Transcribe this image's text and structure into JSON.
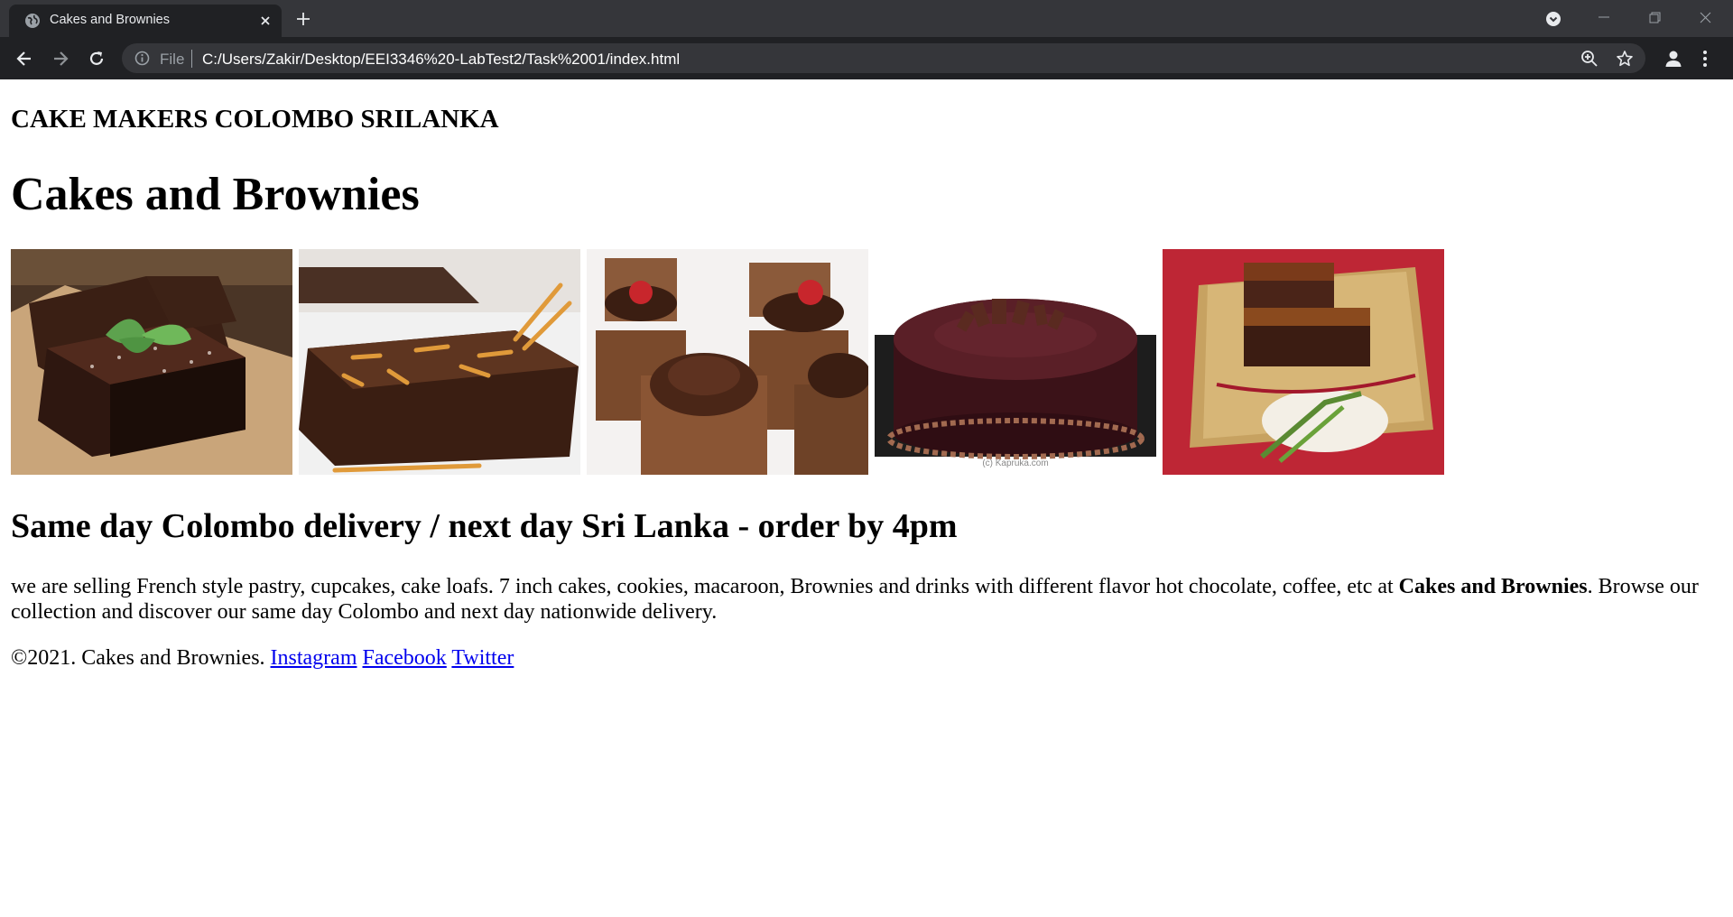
{
  "browser": {
    "tab_title": "Cakes and Brownies",
    "url_scheme": "File",
    "url": "C:/Users/Zakir/Desktop/EEI3346%20-LabTest2/Task%2001/index.html"
  },
  "page": {
    "brand_heading": "CAKE MAKERS COLOMBO SRILANKA",
    "title": "Cakes and Brownies",
    "gallery": [
      {
        "name": "brownies-with-mint-photo"
      },
      {
        "name": "brownie-with-pretzels-photo"
      },
      {
        "name": "chocolate-cupcake-brownies-photo"
      },
      {
        "name": "chocolate-cake-photo",
        "caption": "(c) Kapruka.com"
      },
      {
        "name": "caramel-brownies-photo"
      }
    ],
    "delivery_heading": "Same day Colombo delivery / next day Sri Lanka - order by 4pm",
    "description_before": "we are selling French style pastry, cupcakes, cake loafs. 7 inch cakes, cookies, macaroon, Brownies and drinks with different flavor hot chocolate, coffee, etc at ",
    "description_bold": "Cakes and Brownies",
    "description_after": ". Browse our collection and discover our same day Colombo and next day nationwide delivery.",
    "footer_text": "©2021. Cakes and Brownies.",
    "footer_links": [
      "Instagram",
      "Facebook",
      "Twitter"
    ]
  }
}
